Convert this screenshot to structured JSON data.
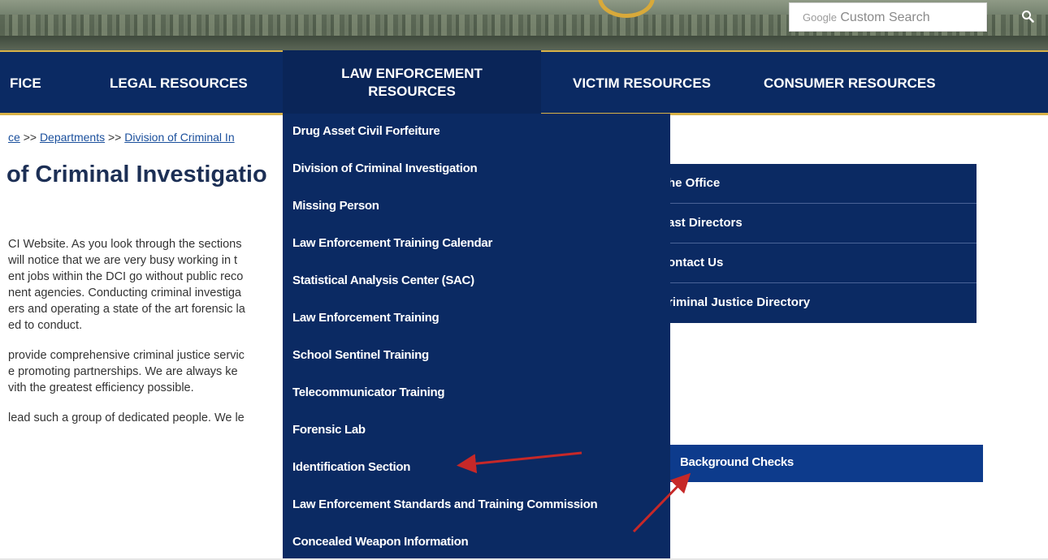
{
  "search": {
    "placeholder_brand": "Google",
    "placeholder_text": "Custom Search"
  },
  "nav": {
    "items": [
      {
        "label": "FICE"
      },
      {
        "label": "LEGAL RESOURCES"
      },
      {
        "label_line1": "LAW ENFORCEMENT",
        "label_line2": "RESOURCES"
      },
      {
        "label": "VICTIM RESOURCES"
      },
      {
        "label": "CONSUMER RESOURCES"
      }
    ]
  },
  "breadcrumb": {
    "part1": "ce",
    "sep": ">>",
    "part2": "Departments",
    "part3": "Division of Criminal In"
  },
  "page": {
    "title": "of Criminal Investigatio",
    "paragraphs": [
      "CI Website. As you look through the sections",
      " will notice that we are very busy working in t",
      "ent jobs within the DCI go without public reco",
      "nent agencies. Conducting criminal investiga",
      "ers and operating a state of the art forensic la",
      "ed to conduct.",
      "provide comprehensive criminal justice servic",
      "e promoting partnerships. We are always ke",
      "vith the greatest efficiency possible.",
      "lead such a group of dedicated people. We le"
    ]
  },
  "side_menu": {
    "items": [
      "he Office",
      "ast Directors",
      "ontact Us",
      "riminal Justice Directory"
    ]
  },
  "dropdown": {
    "items": [
      "Drug Asset Civil Forfeiture",
      "Division of Criminal Investigation",
      "Missing Person",
      "Law Enforcement Training Calendar",
      "Statistical Analysis Center (SAC)",
      "Law Enforcement Training",
      "School Sentinel Training",
      "Telecommunicator Training",
      "Forensic Lab",
      "Identification Section",
      "Law Enforcement Standards and Training Commission",
      "Concealed Weapon Information"
    ],
    "submenu": {
      "label": "Background Checks"
    }
  },
  "colors": {
    "nav_bg": "#0b2a63",
    "accent_gold": "#d9b247",
    "submenu_bg": "#0d3b8c",
    "arrow": "#c62828"
  }
}
